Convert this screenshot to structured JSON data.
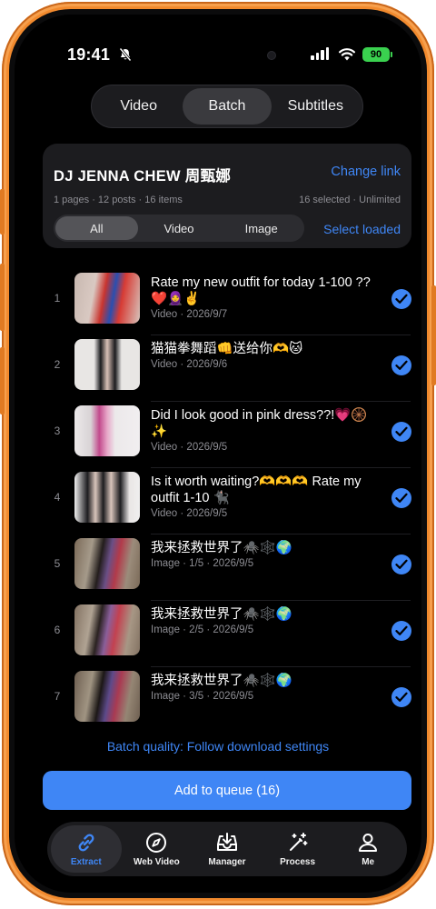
{
  "status_bar": {
    "time": "19:41",
    "battery": "90"
  },
  "segments": [
    {
      "label": "Video",
      "active": false
    },
    {
      "label": "Batch",
      "active": true
    },
    {
      "label": "Subtitles",
      "active": false
    }
  ],
  "header": {
    "title": "DJ JENNA CHEW 周甄娜",
    "change_link": "Change link",
    "stats": "1 pages · 12 posts · 16 items",
    "selection": "16 selected · Unlimited",
    "filters": [
      "All",
      "Video",
      "Image"
    ],
    "active_filter": "All",
    "select_loaded": "Select loaded"
  },
  "items": [
    {
      "num": "1",
      "title": "Rate my new outfit for today 1-100 ?? ❤️🧕✌️",
      "sub": "Video · 2026/9/7",
      "checked": true
    },
    {
      "num": "2",
      "title": "猫猫拳舞蹈👊送给你🫶🐱",
      "sub": "Video · 2026/9/6",
      "checked": true
    },
    {
      "num": "3",
      "title": "Did I look good in pink dress??!💗🛞✨",
      "sub": "Video · 2026/9/5",
      "checked": true
    },
    {
      "num": "4",
      "title": "Is it worth waiting?🫶🫶🫶 Rate my outfit 1-10 🐈‍⬛",
      "sub": "Video · 2026/9/5",
      "checked": true
    },
    {
      "num": "5",
      "title": "我来拯救世界了🕷️🕸️🌍",
      "sub": "Image · 1/5 · 2026/9/5",
      "checked": true
    },
    {
      "num": "6",
      "title": "我来拯救世界了🕷️🕸️🌍",
      "sub": "Image · 2/5 · 2026/9/5",
      "checked": true
    },
    {
      "num": "7",
      "title": "我来拯救世界了🕷️🕸️🌍",
      "sub": "Image · 3/5 · 2026/9/5",
      "checked": true
    }
  ],
  "batch_quality": "Batch quality: Follow download settings",
  "add_button": "Add to queue (16)",
  "tabs": [
    {
      "label": "Extract",
      "icon": "link-icon",
      "active": true
    },
    {
      "label": "Web Video",
      "icon": "compass-icon",
      "active": false
    },
    {
      "label": "Manager",
      "icon": "tray-download-icon",
      "active": false
    },
    {
      "label": "Process",
      "icon": "magic-wand-icon",
      "active": false
    },
    {
      "label": "Me",
      "icon": "person-icon",
      "active": false
    }
  ],
  "colors": {
    "accent": "#3f86f5",
    "frame": "#f28a2e",
    "background": "#000000",
    "card": "#1c1c1f"
  }
}
